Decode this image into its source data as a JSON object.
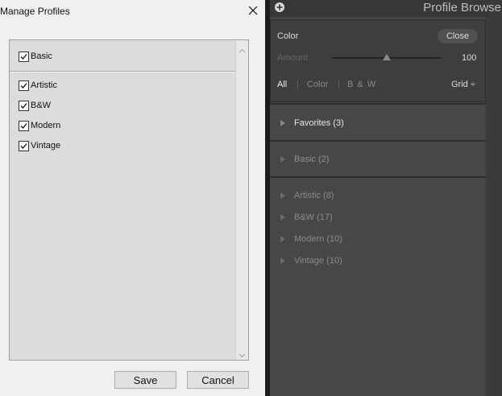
{
  "dialog": {
    "title": "Manage Profiles",
    "items": [
      {
        "label": "Basic",
        "checked": true
      },
      {
        "label": "Artistic",
        "checked": true
      },
      {
        "label": "B&W",
        "checked": true
      },
      {
        "label": "Modern",
        "checked": true
      },
      {
        "label": "Vintage",
        "checked": true
      }
    ],
    "save_label": "Save",
    "cancel_label": "Cancel"
  },
  "panel": {
    "title": "Profile Browser",
    "profile_name": "Color",
    "close_label": "Close",
    "amount_label": "Amount",
    "amount_value": "100",
    "amount_fraction": 0.5,
    "filters": {
      "all": "All",
      "color": "Color",
      "bw": "B & W",
      "sep": "|"
    },
    "view": "Grid ÷",
    "groups": [
      {
        "label": "Favorites (3)"
      },
      {
        "label": "Basic (2)"
      },
      {
        "label": "Artistic (8)"
      },
      {
        "label": "B&W (17)"
      },
      {
        "label": "Modern (10)"
      },
      {
        "label": "Vintage (10)"
      }
    ]
  },
  "colors": {
    "panel_bg": "#474747",
    "dialog_bg": "#f0f0f0",
    "text_light": "#dddddd",
    "text_dim": "#8a8a8a"
  }
}
